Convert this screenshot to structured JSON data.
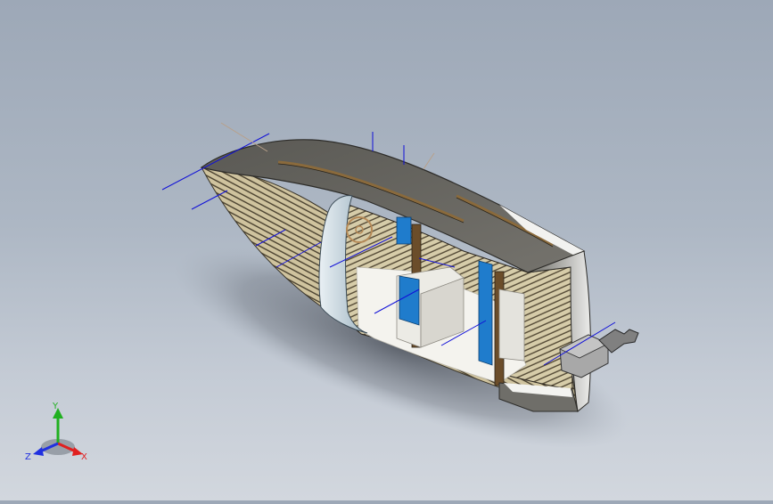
{
  "viewport": {
    "background_top": "#9da8b7",
    "background_bottom": "#d2d7de"
  },
  "model": {
    "hull_color": "#5c5b56",
    "deck_color": "#6e6c66",
    "plank_light": "#d2c6a2",
    "plank_dark": "#4c4331",
    "interior_floor": "#f4f3ee",
    "panel_blue": "#1f7ccc",
    "construction_line_color": "#1010d8",
    "motor_color": "#9a9a9a"
  },
  "triad": {
    "x_label": "X",
    "y_label": "Y",
    "z_label": "Z",
    "x_color": "#e02020",
    "y_color": "#20b020",
    "z_color": "#2030e0"
  }
}
